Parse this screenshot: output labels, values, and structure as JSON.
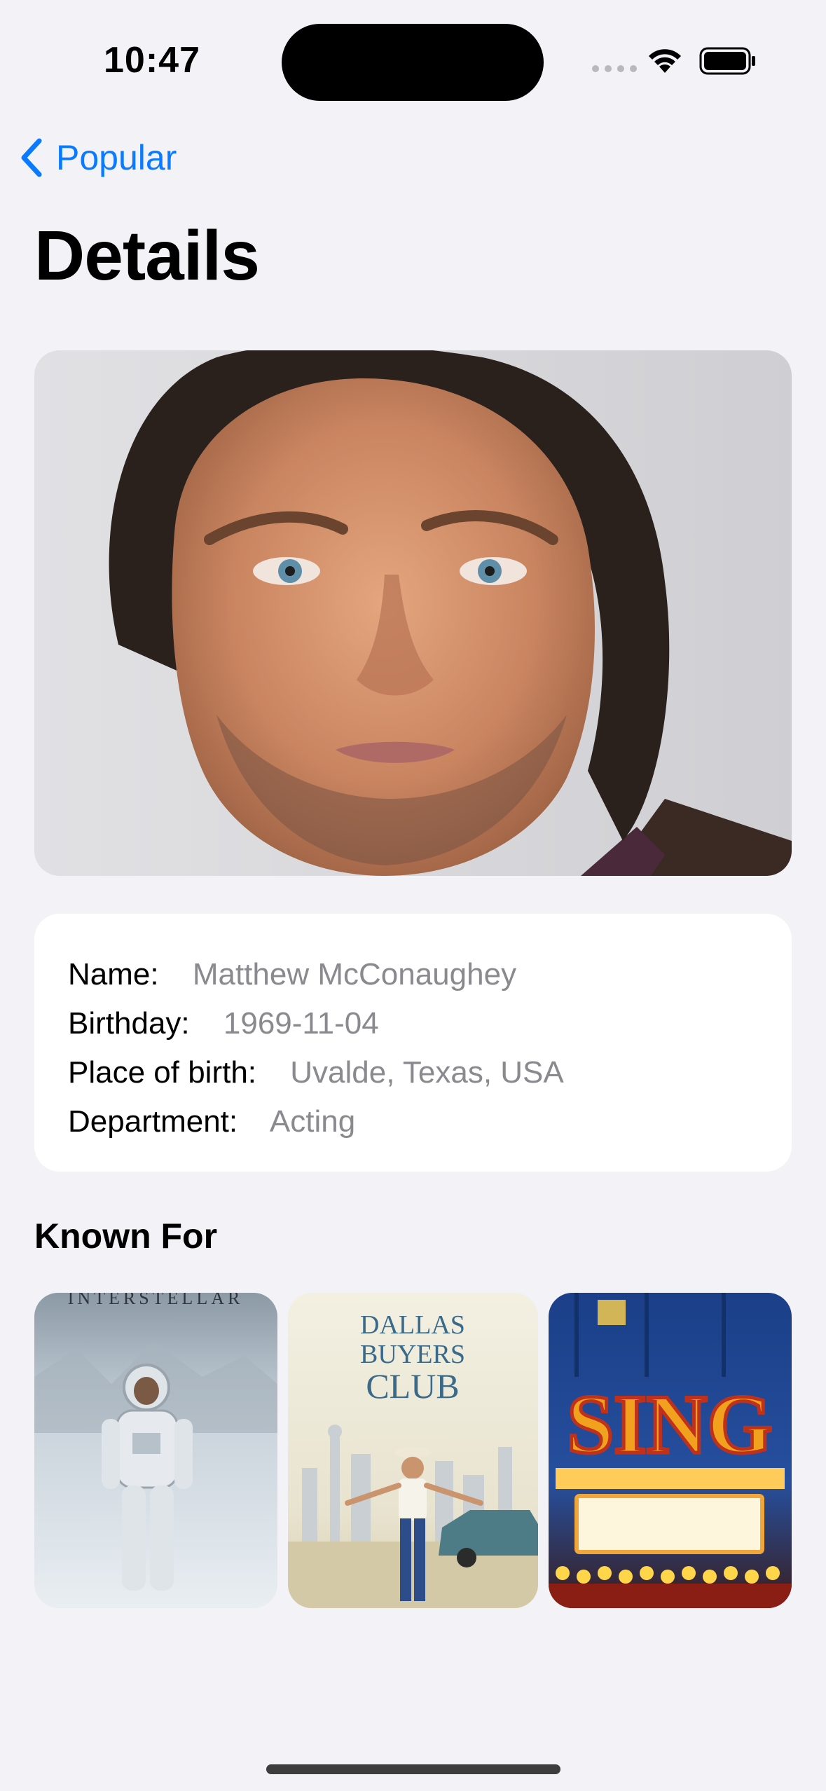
{
  "status_bar": {
    "time": "10:47"
  },
  "nav": {
    "back_label": "Popular"
  },
  "page": {
    "title": "Details"
  },
  "info": {
    "rows": [
      {
        "label": "Name:",
        "value": "Matthew McConaughey"
      },
      {
        "label": "Birthday:",
        "value": "1969-11-04"
      },
      {
        "label": "Place of birth:",
        "value": "Uvalde, Texas, USA"
      },
      {
        "label": "Department:",
        "value": "Acting"
      }
    ]
  },
  "known_for": {
    "heading": "Known For",
    "posters": [
      {
        "title_art": "INTERSTELLAR"
      },
      {
        "title_art_lines": [
          "DALLAS",
          "BUYERS",
          "CLUB"
        ]
      },
      {
        "title_art": "SING"
      }
    ]
  },
  "colors": {
    "accent": "#0a7aff",
    "background": "#f2f2f7",
    "card": "#ffffff",
    "secondary_text": "#8a8a8e"
  }
}
